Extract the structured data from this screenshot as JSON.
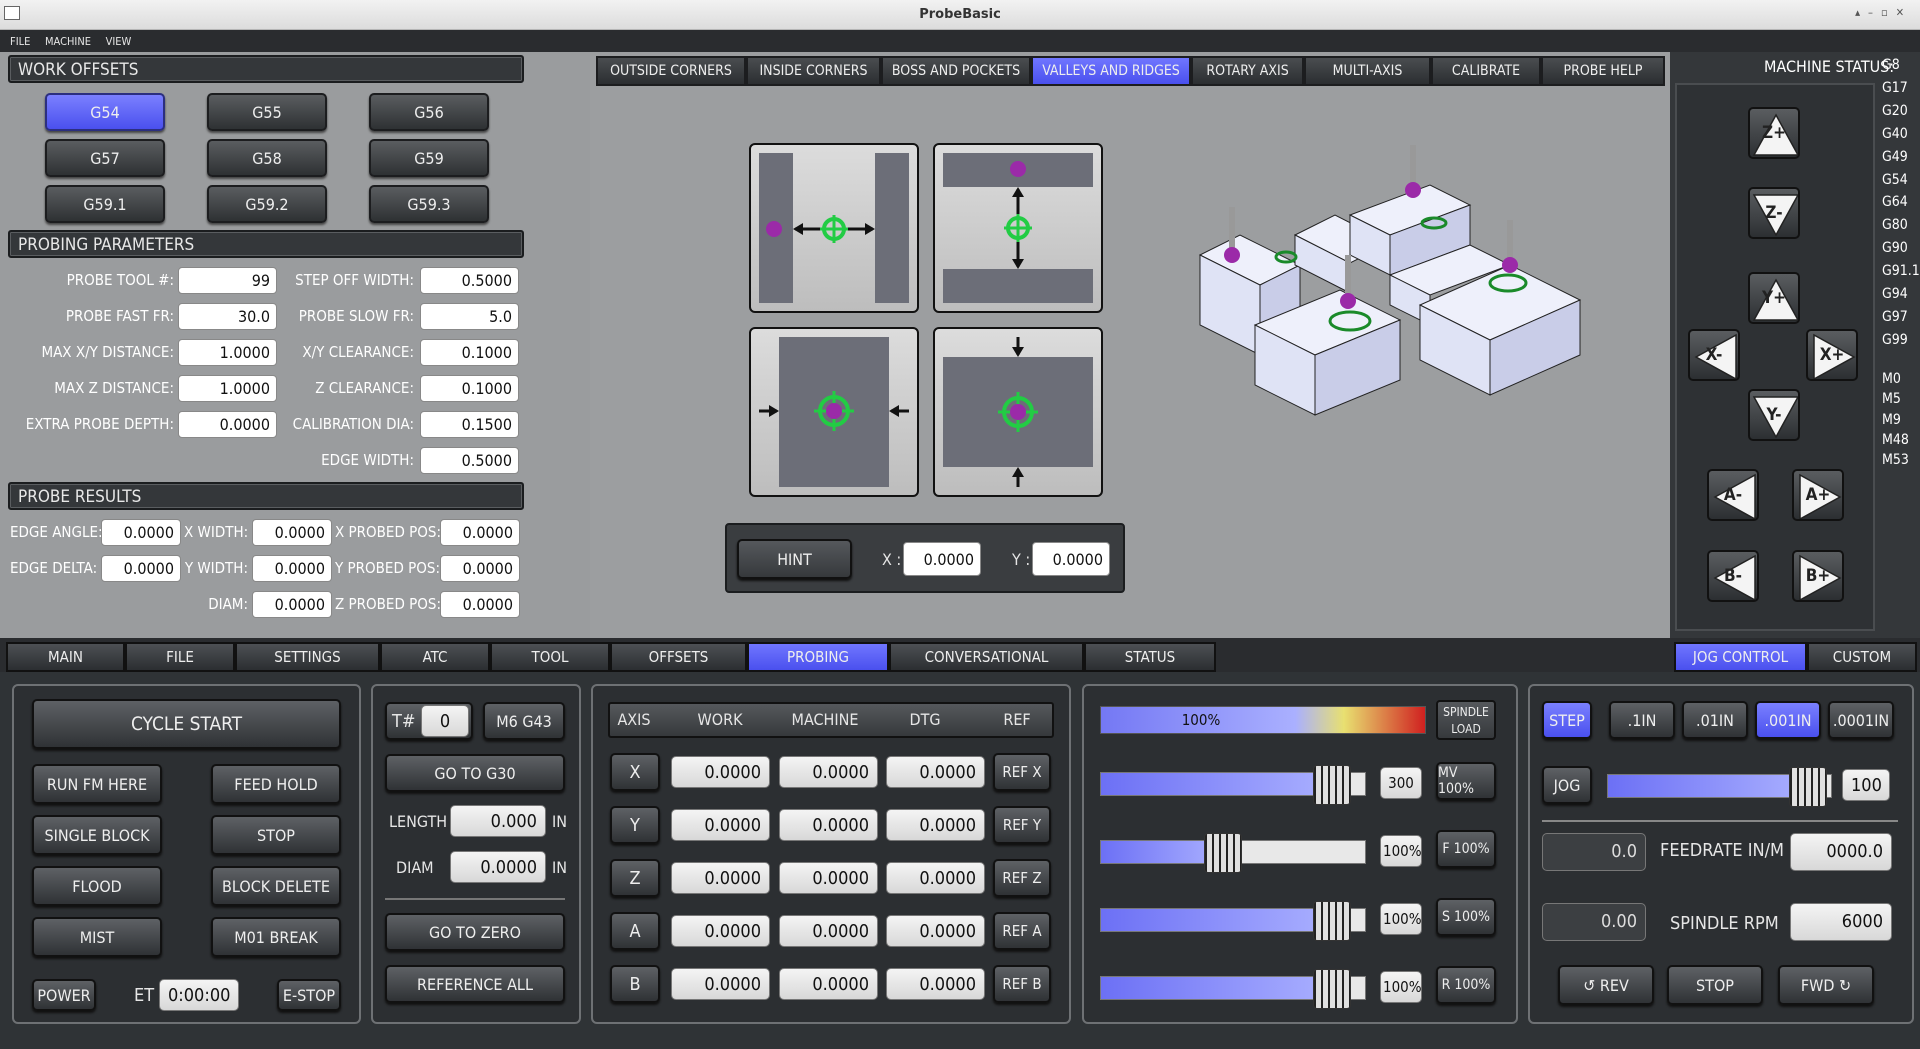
{
  "window": {
    "title": "ProbeBasic"
  },
  "menu": [
    "FILE",
    "MACHINE",
    "VIEW"
  ],
  "work_offsets": {
    "title": "WORK OFFSETS",
    "buttons": [
      "G54",
      "G55",
      "G56",
      "G57",
      "G58",
      "G59",
      "G59.1",
      "G59.2",
      "G59.3"
    ],
    "selected": "G54"
  },
  "probing_params": {
    "title": "PROBING PARAMETERS",
    "left": [
      {
        "label": "PROBE TOOL #:",
        "value": "99"
      },
      {
        "label": "PROBE FAST FR:",
        "value": "30.0"
      },
      {
        "label": "MAX X/Y DISTANCE:",
        "value": "1.0000"
      },
      {
        "label": "MAX Z DISTANCE:",
        "value": "1.0000"
      },
      {
        "label": "EXTRA PROBE DEPTH:",
        "value": "0.0000"
      }
    ],
    "right": [
      {
        "label": "STEP OFF WIDTH:",
        "value": "0.5000"
      },
      {
        "label": "PROBE SLOW FR:",
        "value": "5.0"
      },
      {
        "label": "X/Y CLEARANCE:",
        "value": "0.1000"
      },
      {
        "label": "Z CLEARANCE:",
        "value": "0.1000"
      },
      {
        "label": "CALIBRATION DIA:",
        "value": "0.1500"
      },
      {
        "label": "EDGE WIDTH:",
        "value": "0.5000"
      }
    ]
  },
  "probe_results": {
    "title": "PROBE RESULTS",
    "col1": [
      {
        "label": "EDGE ANGLE:",
        "value": "0.0000"
      },
      {
        "label": "EDGE DELTA:",
        "value": "0.0000"
      }
    ],
    "col2": [
      {
        "label": "X WIDTH:",
        "value": "0.0000"
      },
      {
        "label": "Y WIDTH:",
        "value": "0.0000"
      },
      {
        "label": "DIAM:",
        "value": "0.0000"
      }
    ],
    "col3": [
      {
        "label": "X PROBED POS:",
        "value": "0.0000"
      },
      {
        "label": "Y PROBED POS:",
        "value": "0.0000"
      },
      {
        "label": "Z PROBED POS:",
        "value": "0.0000"
      }
    ]
  },
  "probe_tabs": [
    "OUTSIDE CORNERS",
    "INSIDE CORNERS",
    "BOSS AND POCKETS",
    "VALLEYS AND RIDGES",
    "ROTARY AXIS",
    "MULTI-AXIS",
    "CALIBRATE",
    "PROBE HELP"
  ],
  "probe_tab_selected": "VALLEYS AND RIDGES",
  "hint": {
    "button": "HINT",
    "x_label": "X :",
    "x_value": "0.0000",
    "y_label": "Y :",
    "y_value": "0.0000"
  },
  "machine_status": {
    "label": "MACHINE STATUS:",
    "codes": [
      "G8",
      "G17",
      "G20",
      "G40",
      "G49",
      "G54",
      "G64",
      "G80",
      "G90",
      "G91.1",
      "G94",
      "G97",
      "G99",
      "M0",
      "M5",
      "M9",
      "M48",
      "M53"
    ]
  },
  "jog_buttons": [
    "Z+",
    "Z-",
    "Y+",
    "X-",
    "X+",
    "Y-",
    "A-",
    "A+",
    "B-",
    "B+"
  ],
  "bottom_tabs": [
    "MAIN",
    "FILE",
    "SETTINGS",
    "ATC",
    "TOOL",
    "OFFSETS",
    "PROBING",
    "CONVERSATIONAL",
    "STATUS"
  ],
  "bottom_tab_selected": "PROBING",
  "right_tabs": [
    "JOG CONTROL",
    "CUSTOM"
  ],
  "right_tab_selected": "JOG CONTROL",
  "cycle": {
    "start": "CYCLE START",
    "run_from_here": "RUN FM HERE",
    "feed_hold": "FEED HOLD",
    "single_block": "SINGLE BLOCK",
    "stop": "STOP",
    "flood": "FLOOD",
    "block_delete": "BLOCK DELETE",
    "mist": "MIST",
    "m01_break": "M01 BREAK",
    "power": "POWER",
    "et_label": "ET",
    "et_value": "0:00:00",
    "estop": "E-STOP"
  },
  "tool": {
    "t_label": "T#",
    "t_value": "0",
    "m6": "M6 G43",
    "go_g30": "GO TO G30",
    "length_label": "LENGTH",
    "length_value": "0.000",
    "length_unit": "IN",
    "diam_label": "DIAM",
    "diam_value": "0.0000",
    "diam_unit": "IN",
    "go_zero": "GO TO ZERO",
    "ref_all": "REFERENCE ALL"
  },
  "dro": {
    "headers": [
      "AXIS",
      "WORK",
      "MACHINE",
      "DTG",
      "REF"
    ],
    "rows": [
      {
        "axis": "X",
        "work": "0.0000",
        "machine": "0.0000",
        "dtg": "0.0000",
        "ref": "REF X"
      },
      {
        "axis": "Y",
        "work": "0.0000",
        "machine": "0.0000",
        "dtg": "0.0000",
        "ref": "REF Y"
      },
      {
        "axis": "Z",
        "work": "0.0000",
        "machine": "0.0000",
        "dtg": "0.0000",
        "ref": "REF Z"
      },
      {
        "axis": "A",
        "work": "0.0000",
        "machine": "0.0000",
        "dtg": "0.0000",
        "ref": "REF A"
      },
      {
        "axis": "B",
        "work": "0.0000",
        "machine": "0.0000",
        "dtg": "0.0000",
        "ref": "REF B"
      }
    ]
  },
  "overrides": {
    "spindle_load_label": "SPINDLE LOAD",
    "spindle_load_value": "100%",
    "spindle_load_fraction": 1.0,
    "rows": [
      {
        "value": "300",
        "button": "MV 100%",
        "fraction": 0.87
      },
      {
        "value": "100%",
        "button": "F 100%",
        "fraction": 0.46
      },
      {
        "value": "100%",
        "button": "S 100%",
        "fraction": 0.87
      },
      {
        "value": "100%",
        "button": "R 100%",
        "fraction": 0.87
      }
    ]
  },
  "jog": {
    "step": "STEP",
    "increments": [
      ".1IN",
      ".01IN",
      ".001IN",
      ".0001IN"
    ],
    "selected_increment": ".001IN",
    "jog_label": "JOG",
    "jog_value": "100",
    "jog_fraction": 0.89,
    "feed_value": "0.0",
    "feed_label": "FEEDRATE IN/M",
    "feed_set": "0000.0",
    "rpm_value": "0.00",
    "rpm_label": "SPINDLE RPM",
    "rpm_set": "6000",
    "rev": "REV",
    "stop": "STOP",
    "fwd": "FWD"
  },
  "colors": {
    "accent": "#5a5ff5",
    "panel": "#2c2f32",
    "probe_green": "#22cc44",
    "probe_purple": "#9b2aa8"
  }
}
